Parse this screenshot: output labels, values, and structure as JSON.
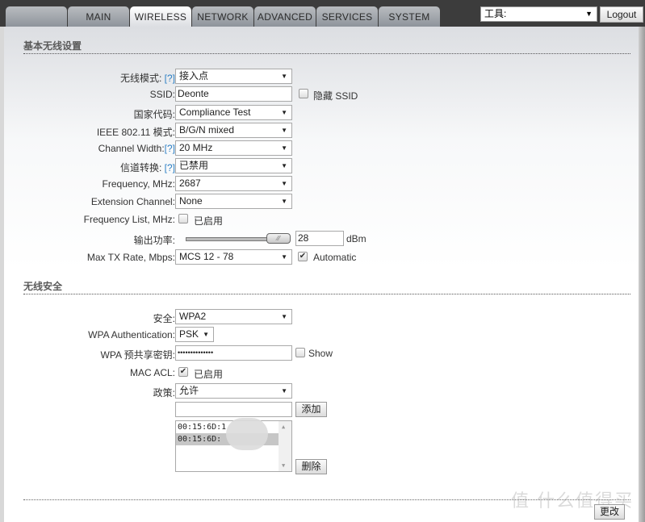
{
  "tabs": [
    {
      "label": ""
    },
    {
      "label": "MAIN"
    },
    {
      "label": "WIRELESS",
      "active": true
    },
    {
      "label": "NETWORK"
    },
    {
      "label": "ADVANCED"
    },
    {
      "label": "SERVICES"
    },
    {
      "label": "SYSTEM"
    }
  ],
  "header": {
    "tools_select": "工具:",
    "logout_label": "Logout"
  },
  "basic": {
    "title": "基本无线设置",
    "wireless_mode": {
      "label": "无线模式:",
      "help": "[?]",
      "value": "接入点"
    },
    "ssid": {
      "label": "SSID:",
      "value": "Deonte",
      "hide_label": "隐藏 SSID",
      "hide_checked": false
    },
    "country_code": {
      "label": "国家代码:",
      "value": "Compliance Test"
    },
    "ieee_mode": {
      "label": "IEEE 802.11 模式:",
      "value": "B/G/N mixed"
    },
    "channel_width": {
      "label": "Channel Width:",
      "help": "[?]",
      "value": "20 MHz"
    },
    "channel_shift": {
      "label": "信道转换:",
      "help": "[?]",
      "value": "已禁用"
    },
    "frequency": {
      "label": "Frequency, MHz:",
      "value": "2687"
    },
    "extension_channel": {
      "label": "Extension Channel:",
      "value": "None"
    },
    "frequency_list": {
      "label": "Frequency List, MHz:",
      "enabled_label": "已启用",
      "checked": false
    },
    "output_power": {
      "label": "输出功率:",
      "value": "28",
      "unit": "dBm",
      "slider_fraction": 1.0
    },
    "max_tx_rate": {
      "label": "Max TX Rate, Mbps:",
      "value": "MCS 12 - 78",
      "auto_label": "Automatic",
      "auto_checked": true
    }
  },
  "security": {
    "title": "无线安全",
    "security": {
      "label": "安全:",
      "value": "WPA2"
    },
    "wpa_auth": {
      "label": "WPA Authentication:",
      "value": "PSK"
    },
    "wpa_key": {
      "label": "WPA 预共享密钥:",
      "value": "••••••••••••••",
      "show_label": "Show",
      "show_checked": false
    },
    "mac_acl": {
      "label": "MAC ACL:",
      "enabled_label": "已启用",
      "checked": true
    },
    "policy": {
      "label": "政策:",
      "value": "允许"
    },
    "mac_input": {
      "value": ""
    },
    "add_label": "添加",
    "mac_list": [
      "00:15:6D:1",
      "00:15:6D:"
    ],
    "delete_label": "删除"
  },
  "footer": {
    "change_label": "更改",
    "watermark": "值 什么值得买"
  }
}
